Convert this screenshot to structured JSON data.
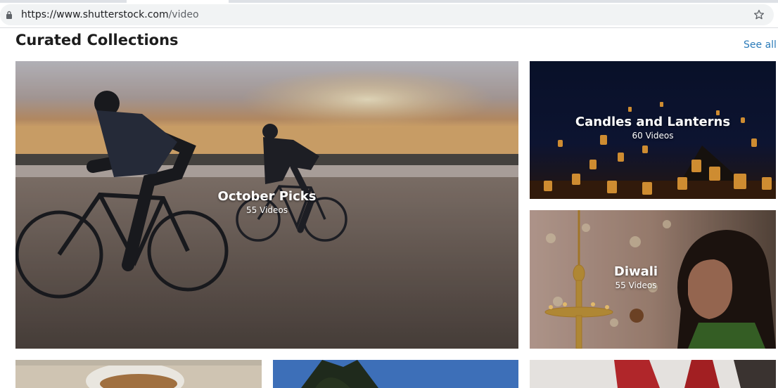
{
  "browser": {
    "url_host": "https://www.shutterstock.com",
    "url_path": "/video"
  },
  "section": {
    "title": "Curated Collections",
    "see_all_label": "See all"
  },
  "collections": [
    {
      "title": "October Picks",
      "count": "55 Videos"
    },
    {
      "title": "Candles and Lanterns",
      "count": "60 Videos"
    },
    {
      "title": "Diwali",
      "count": "55 Videos"
    }
  ],
  "colors": {
    "link": "#2b7bb9",
    "heading": "#1d1d1d"
  }
}
